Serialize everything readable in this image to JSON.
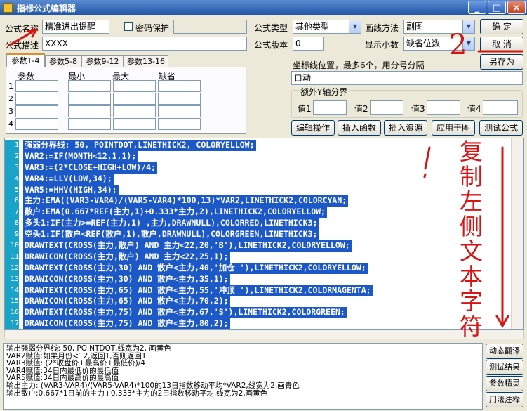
{
  "window": {
    "title": "指标公式编辑器",
    "minimize": "_",
    "maximize": "□",
    "close": "×"
  },
  "form": {
    "formula_name_label": "公式名称",
    "formula_name_value": "精准进出提醒",
    "password_label": "密码保护",
    "formula_desc_label": "公式描述",
    "formula_desc_value": "XXXX",
    "formula_type_label": "公式类型",
    "formula_type_value": "其他类型",
    "draw_method_label": "画线方法",
    "draw_method_value": "副图",
    "version_label": "公式版本",
    "version_value": "0",
    "decimal_label": "显示小数",
    "decimal_value": "缺省位数"
  },
  "buttons": {
    "confirm": "确 定",
    "cancel": "取 消",
    "save_as": "另存为",
    "edit_op": "编辑操作",
    "insert_func": "插入函数",
    "insert_res": "插入资源",
    "apply_chart": "应用于图",
    "test_formula": "测试公式",
    "dynamic_translate": "动态翻译",
    "test_result": "测试结果",
    "param_wizard": "参数精灵",
    "usage_note": "用法注释"
  },
  "tabs": [
    "参数1-4",
    "参数5-8",
    "参数9-12",
    "参数13-16"
  ],
  "param_grid": {
    "headers": [
      "参数",
      "最小",
      "最大",
      "缺省"
    ],
    "rows": [
      "1",
      "2",
      "3",
      "4"
    ]
  },
  "coord": {
    "label": "坐标线位置，最多6个，用分号分隔",
    "value": "自动",
    "extra_axis_label": "额外Y轴分界",
    "values": [
      "值1",
      "值2",
      "值3",
      "值4"
    ]
  },
  "code_lines": [
    "强弱分界线: 50, POINTDOT,LINETHICK2, COLORYELLOW;",
    "VAR2:=IF(MONTH<12,1,1);",
    "VAR3:=(2*CLOSE+HIGH+LOW)/4;",
    "VAR4:=LLV(LOW,34);",
    "VAR5:=HHV(HIGH,34);",
    "主力:EMA((VAR3-VAR4)/(VAR5-VAR4)*100,13)*VAR2,LINETHICK2,COLORCYAN;",
    "散户:EMA(0.667*REF(主力,1)+0.333*主力,2),LINETHICK2,COLORYELLOW;",
    "多头1:IF(主力>=REF(主力,1) ,主力,DRAWNULL),COLORRED,LINETHICK3;",
    "空头1:IF(散户<REF(散户,1),散户,DRAWNULL),COLORGREEN,LINETHICK3;",
    "DRAWTEXT(CROSS(主力,散户) AND 主力<22,20,'B'),LINETHICK2,COLORYELLOW;",
    "DRAWICON(CROSS(主力,散户) AND 主力<22,25,1);",
    "DRAWTEXT(CROSS(主力,30) AND 散户<主力,40,'加仓 '),LINETHICK2,COLORYELLOW;",
    "DRAWICON(CROSS(主力,30) AND 散户<主力,35,1);",
    "DRAWTEXT(CROSS(主力,65) AND 散户<主力,55,'冲顶 '),LINETHICK2,COLORMAGENTA;",
    "DRAWICON(CROSS(主力,65) AND 散户<主力,70,2);",
    "DRAWTEXT(CROSS(主力,75) AND 散户<主力,67,'S'),LINETHICK2,COLORGREEN;",
    "DRAWICON(CROSS(主力,75) AND 散户<主力,80,2);"
  ],
  "output_lines": [
    "输出强弱分界线: 50, POINTDOT,线宽为2, 画黄色",
    "VAR2赋值:如果月份<12,返回1,否则返回1",
    "VAR3赋值: (2*收盘价+最高价+最低价)/4",
    "VAR4赋值:34日内最低价的最低值",
    "VAR5赋值:34日内最高价的最高值",
    "输出主力: (VAR3-VAR4)/(VAR5-VAR4)*100的13日指数移动平均*VAR2,线宽为2,画青色",
    "输出散户:0.667*1日前的主力+0.333*主力的2日指数移动平均,线宽为2,画黄色"
  ],
  "annotations": {
    "number": "2",
    "side_text": "复制左侧文本字符"
  },
  "colors": {
    "code_bg": "#1d58c7",
    "gutter": "#1aa3c9",
    "annotation": "#d61414"
  }
}
